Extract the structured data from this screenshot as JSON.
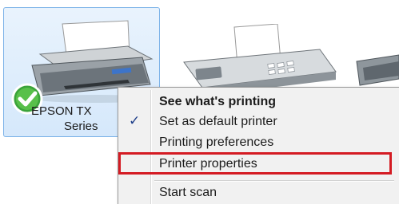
{
  "devices": [
    {
      "label_line1": "EPSON TX",
      "label_line2": "Series",
      "status_icon": "green-check-icon",
      "icon": "printer-icon",
      "selected": true
    },
    {
      "icon": "fax-icon"
    },
    {
      "icon": "printer-icon"
    }
  ],
  "context_menu": {
    "items": [
      {
        "label": "See what's printing",
        "bold": true,
        "checked": false
      },
      {
        "label": "Set as default printer",
        "bold": false,
        "checked": true
      },
      {
        "label": "Printing preferences",
        "bold": false,
        "checked": false
      },
      {
        "label": "Printer properties",
        "bold": false,
        "checked": false,
        "annotated": true
      },
      {
        "label": "Start scan",
        "bold": false,
        "checked": false
      }
    ],
    "check_glyph": "✓"
  },
  "colors": {
    "highlight_box": "#d41b23",
    "selection_fill": "#d5e8fb",
    "selection_border": "#7db3e8",
    "menu_bg": "#f1f1f1"
  }
}
